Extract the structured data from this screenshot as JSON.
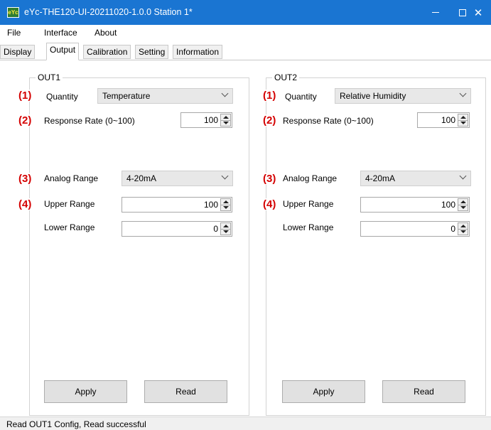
{
  "window": {
    "title": "eYc-THE120-UI-20211020-1.0.0  Station 1*",
    "icon_text": "eYc",
    "minimize_glyph": "—",
    "maximize_glyph": "☐",
    "close_glyph": "✕"
  },
  "menu": [
    "File",
    "Interface",
    "About"
  ],
  "tabs": [
    {
      "label": "Display",
      "active": false
    },
    {
      "label": "Output",
      "active": true
    },
    {
      "label": "Calibration",
      "active": false
    },
    {
      "label": "Setting",
      "active": false
    },
    {
      "label": "Information",
      "active": false
    }
  ],
  "markers": [
    "(1)",
    "(2)",
    "(3)",
    "(4)"
  ],
  "out1": {
    "title": "OUT1",
    "quantity_label": "Quantity",
    "quantity_value": "Temperature",
    "response_label": "Response Rate (0~100)",
    "response_value": "100",
    "analog_label": "Analog Range",
    "analog_value": "4-20mA",
    "upper_label": "Upper Range",
    "upper_value": "100",
    "lower_label": "Lower Range",
    "lower_value": "0",
    "apply_label": "Apply",
    "read_label": "Read"
  },
  "out2": {
    "title": "OUT2",
    "quantity_label": "Quantity",
    "quantity_value": "Relative Humidity",
    "response_label": "Response Rate (0~100)",
    "response_value": "100",
    "analog_label": "Analog Range",
    "analog_value": "4-20mA",
    "upper_label": "Upper Range",
    "upper_value": "100",
    "lower_label": "Lower Range",
    "lower_value": "0",
    "apply_label": "Apply",
    "read_label": "Read"
  },
  "status": {
    "text": "Read OUT1 Config,   Read successful"
  },
  "colors": {
    "titlebar": "#1a75d2",
    "marker": "#d40000",
    "combo_bg": "#e8e8e8",
    "button_bg": "#e1e1e1"
  }
}
